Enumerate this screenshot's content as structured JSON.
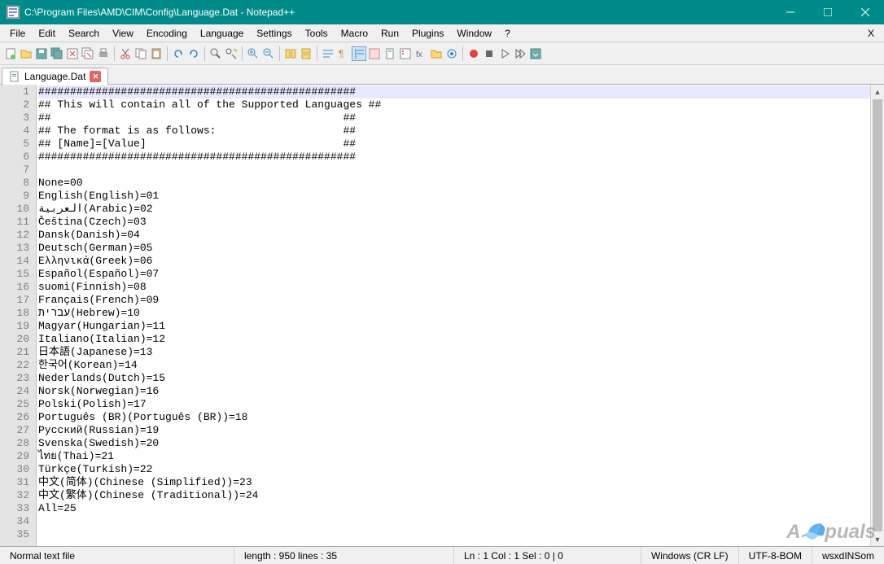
{
  "window": {
    "title": "C:\\Program Files\\AMD\\CIM\\Config\\Language.Dat - Notepad++"
  },
  "menu": {
    "items": [
      "File",
      "Edit",
      "Search",
      "View",
      "Encoding",
      "Language",
      "Settings",
      "Tools",
      "Macro",
      "Run",
      "Plugins",
      "Window",
      "?"
    ],
    "x_right": "X"
  },
  "tab": {
    "label": "Language.Dat"
  },
  "editor": {
    "lines": [
      "##################################################",
      "## This will contain all of the Supported Languages ##",
      "##                                              ##",
      "## The format is as follows:                    ##",
      "## [Name]=[Value]                               ##",
      "##################################################",
      "",
      "None=00",
      "English(English)=01",
      "العربية(Arabic)=02",
      "Čeština(Czech)=03",
      "Dansk(Danish)=04",
      "Deutsch(German)=05",
      "Ελληνικά(Greek)=06",
      "Español(Español)=07",
      "suomi(Finnish)=08",
      "Français(French)=09",
      "עברית(Hebrew)=10",
      "Magyar(Hungarian)=11",
      "Italiano(Italian)=12",
      "日本語(Japanese)=13",
      "한국어(Korean)=14",
      "Nederlands(Dutch)=15",
      "Norsk(Norwegian)=16",
      "Polski(Polish)=17",
      "Português (BR)(Português (BR))=18",
      "Русский(Russian)=19",
      "Svenska(Swedish)=20",
      "ไทย(Thai)=21",
      "Türkçe(Turkish)=22",
      "中文(简体)(Chinese (Simplified))=23",
      "中文(繁体)(Chinese (Traditional))=24",
      "All=25",
      "",
      ""
    ],
    "line_count": 35
  },
  "status": {
    "type": "Normal text file",
    "length_label": "length : 950    lines : 35",
    "position_label": "Ln : 1    Col : 1    Sel : 0 | 0",
    "eol": "Windows (CR LF)",
    "encoding": "UTF-8-BOM",
    "ins": "wsxdINSom"
  },
  "watermark": "A🧢puals"
}
